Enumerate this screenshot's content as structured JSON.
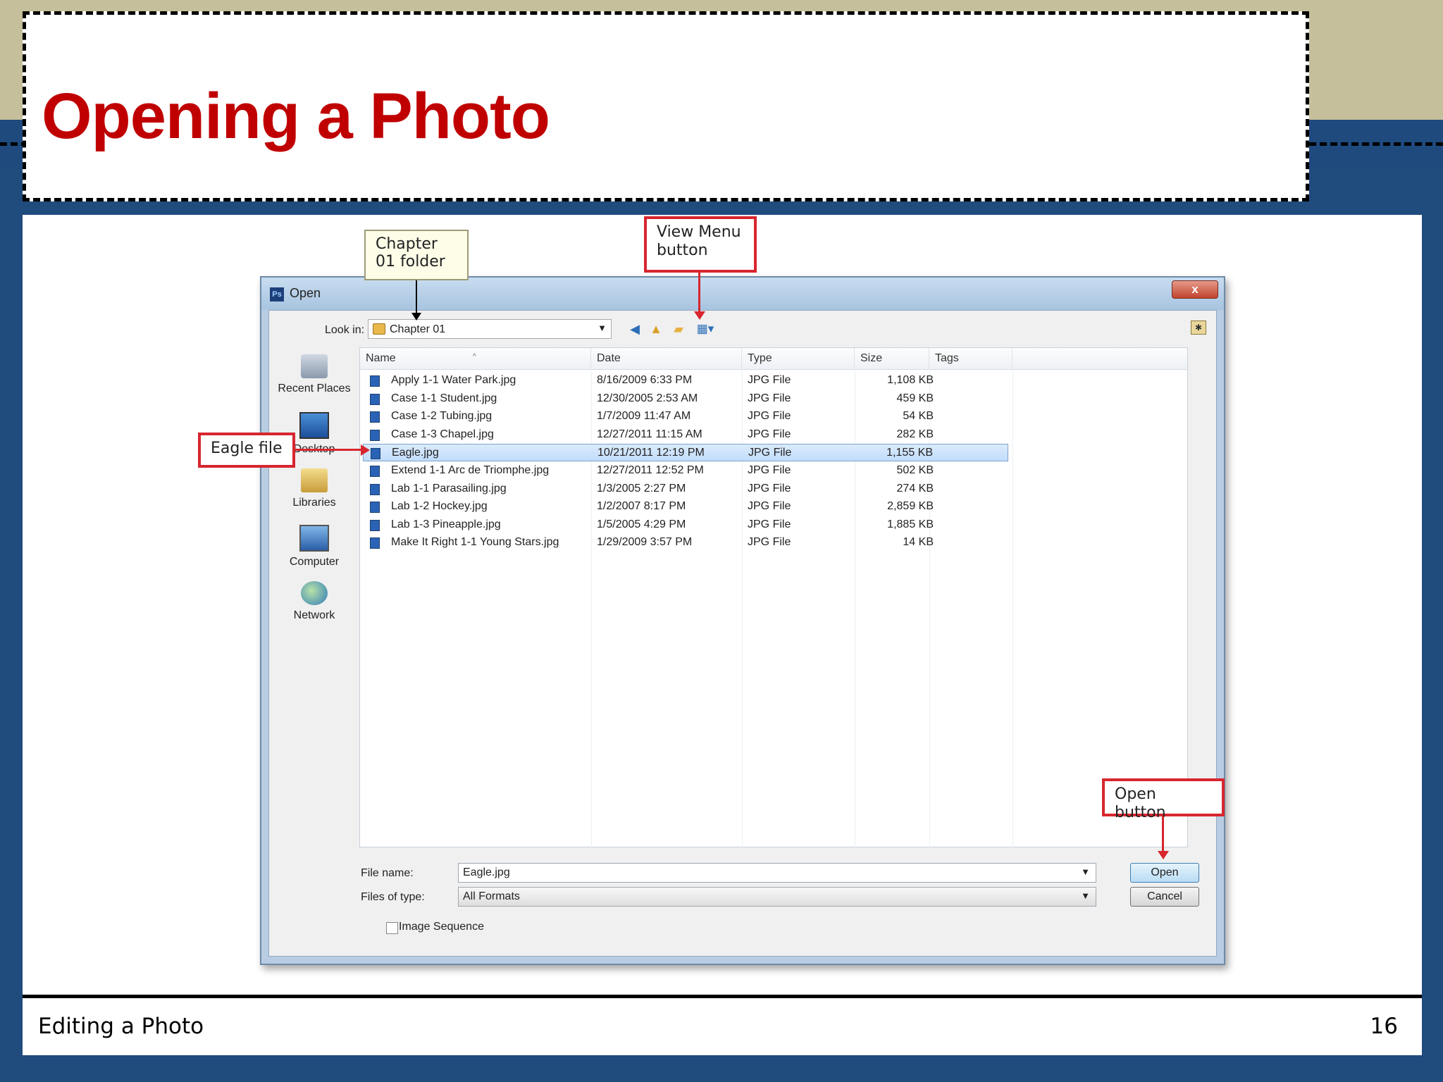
{
  "slide": {
    "title": "Opening a Photo",
    "footer_text": "Editing a Photo",
    "page_number": "16"
  },
  "dialog": {
    "title": "Open",
    "app_icon_label": "Ps",
    "close_label": "x",
    "look_in_label": "Look in:",
    "look_in_value": "Chapter 01",
    "places": [
      "Recent Places",
      "Desktop",
      "Libraries",
      "Computer",
      "Network"
    ],
    "columns": [
      "Name",
      "Date",
      "Type",
      "Size",
      "Tags"
    ],
    "files": [
      {
        "name": "Apply 1-1 Water Park.jpg",
        "date": "8/16/2009 6:33 PM",
        "type": "JPG File",
        "size": "1,108 KB",
        "selected": false
      },
      {
        "name": "Case 1-1 Student.jpg",
        "date": "12/30/2005 2:53 AM",
        "type": "JPG File",
        "size": "459 KB",
        "selected": false
      },
      {
        "name": "Case 1-2 Tubing.jpg",
        "date": "1/7/2009 11:47 AM",
        "type": "JPG File",
        "size": "54 KB",
        "selected": false
      },
      {
        "name": "Case 1-3 Chapel.jpg",
        "date": "12/27/2011 11:15 AM",
        "type": "JPG File",
        "size": "282 KB",
        "selected": false
      },
      {
        "name": "Eagle.jpg",
        "date": "10/21/2011 12:19 PM",
        "type": "JPG File",
        "size": "1,155 KB",
        "selected": true
      },
      {
        "name": "Extend 1-1 Arc de Triomphe.jpg",
        "date": "12/27/2011 12:52 PM",
        "type": "JPG File",
        "size": "502 KB",
        "selected": false
      },
      {
        "name": "Lab 1-1 Parasailing.jpg",
        "date": "1/3/2005 2:27 PM",
        "type": "JPG File",
        "size": "274 KB",
        "selected": false
      },
      {
        "name": "Lab 1-2 Hockey.jpg",
        "date": "1/2/2007 8:17 PM",
        "type": "JPG File",
        "size": "2,859 KB",
        "selected": false
      },
      {
        "name": "Lab 1-3 Pineapple.jpg",
        "date": "1/5/2005 4:29 PM",
        "type": "JPG File",
        "size": "1,885 KB",
        "selected": false
      },
      {
        "name": "Make It Right 1-1 Young Stars.jpg",
        "date": "1/29/2009 3:57 PM",
        "type": "JPG File",
        "size": "14 KB",
        "selected": false
      }
    ],
    "file_name_label": "File name:",
    "file_name_value": "Eagle.jpg",
    "files_of_type_label": "Files of type:",
    "files_of_type_value": "All Formats",
    "open_label": "Open",
    "cancel_label": "Cancel",
    "image_sequence_label": "Image Sequence"
  },
  "callouts": {
    "chapter_folder": "Chapter 01 folder",
    "view_menu": "View Menu button",
    "eagle_file": "Eagle file",
    "open_button": "Open button"
  },
  "colors": {
    "title_red": "#c00000",
    "callout_red": "#d7262f",
    "slide_blue": "#204b7d",
    "tan": "#c6bf9b",
    "selection": "#c1dcfc"
  },
  "icons": {
    "back": "back-arrow-icon",
    "up": "up-folder-icon",
    "new_folder": "new-folder-icon",
    "view_menu": "view-menu-icon"
  }
}
